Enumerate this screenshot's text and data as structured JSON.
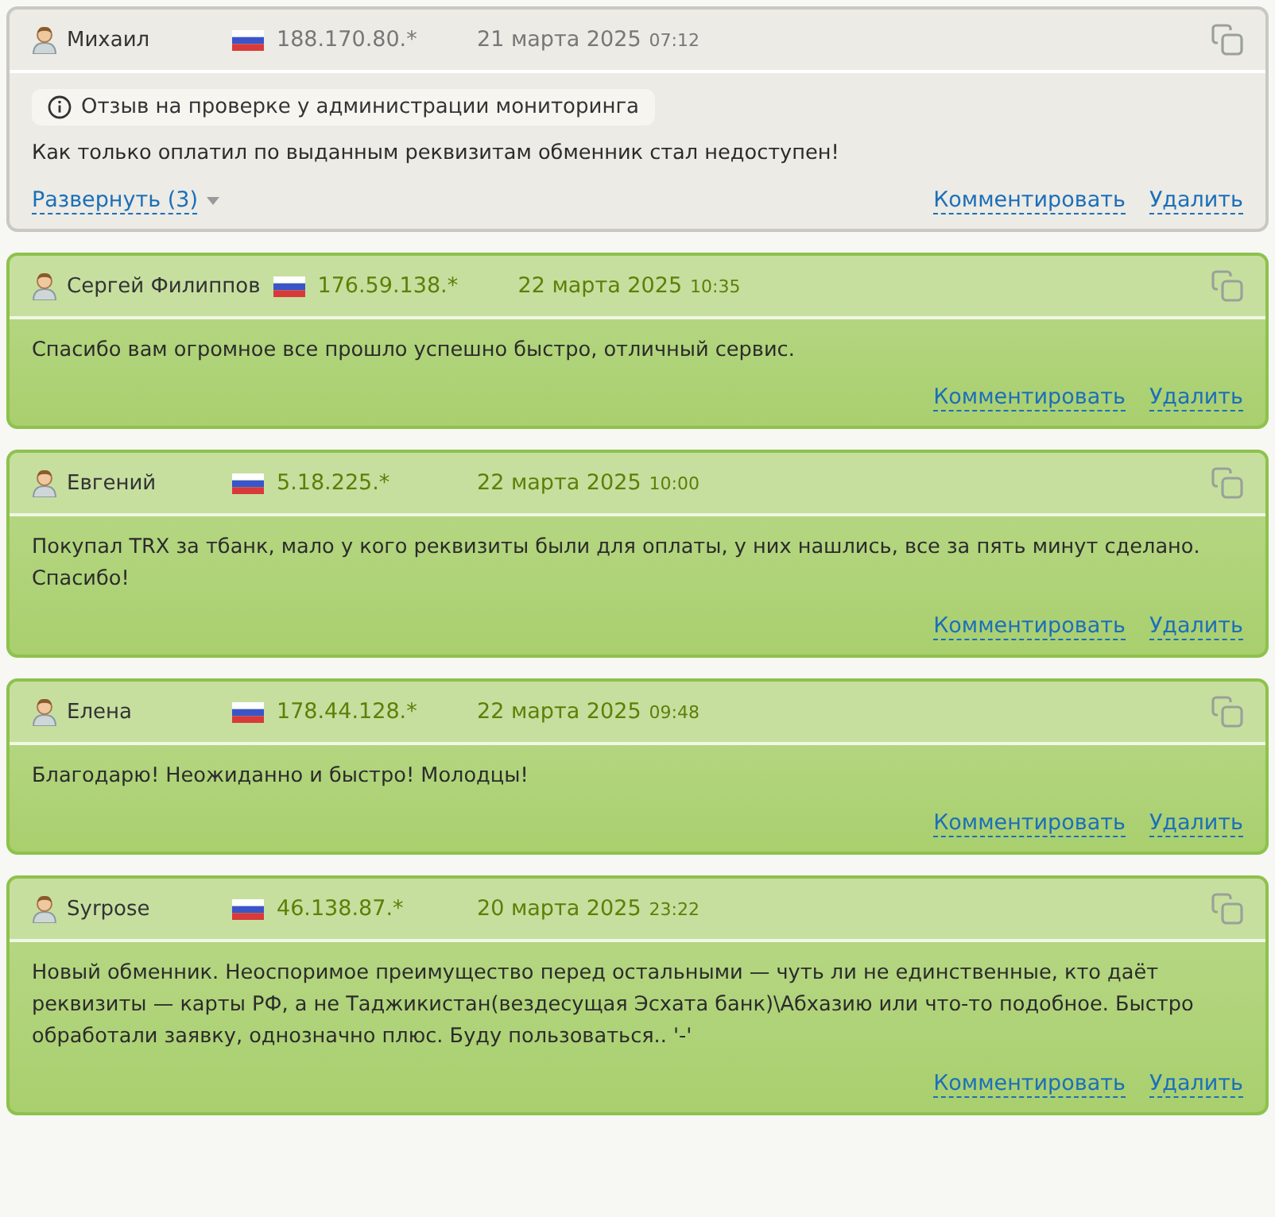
{
  "reviews": [
    {
      "kind": "neutral",
      "author": "Михаил",
      "ip": "188.170.80.*",
      "date": "21 марта 2025",
      "time": "07:12",
      "notice": "Отзыв на проверке у администрации мониторинга",
      "text": "Как только оплатил по выданным реквизитам обменник стал недоступен!",
      "expand": "Развернуть (3)",
      "actions": [
        "Комментировать",
        "Удалить"
      ]
    },
    {
      "kind": "positive",
      "author": "Сергей Филиппов",
      "ip": "176.59.138.*",
      "date": "22 марта 2025",
      "time": "10:35",
      "text": "Спасибо вам огромное все прошло успешно быстро, отличный сервис.",
      "actions": [
        "Комментировать",
        "Удалить"
      ]
    },
    {
      "kind": "positive",
      "author": "Евгений",
      "ip": "5.18.225.*",
      "date": "22 марта 2025",
      "time": "10:00",
      "text": "Покупал TRX за тбанк, мало у кого реквизиты были для оплаты, у них нашлись, все за пять минут сделано. Спасибо!",
      "actions": [
        "Комментировать",
        "Удалить"
      ]
    },
    {
      "kind": "positive",
      "author": "Елена",
      "ip": "178.44.128.*",
      "date": "22 марта 2025",
      "time": "09:48",
      "text": "Благодарю! Неожиданно и быстро! Молодцы!",
      "actions": [
        "Комментировать",
        "Удалить"
      ]
    },
    {
      "kind": "positive",
      "author": "Syrpose",
      "ip": "46.138.87.*",
      "date": "20 марта 2025",
      "time": "23:22",
      "text": "Новый обменник. Неоспоримое преимущество перед остальными — чуть ли не единственные, кто даёт реквизиты — карты РФ, а не Таджикистан(вездесущая Эсхата банк)\\Абхазию или что-то подобное. Быстро обработали заявку, однозначно плюс. Буду пользоваться.. '-'",
      "actions": [
        "Комментировать",
        "Удалить"
      ]
    }
  ]
}
